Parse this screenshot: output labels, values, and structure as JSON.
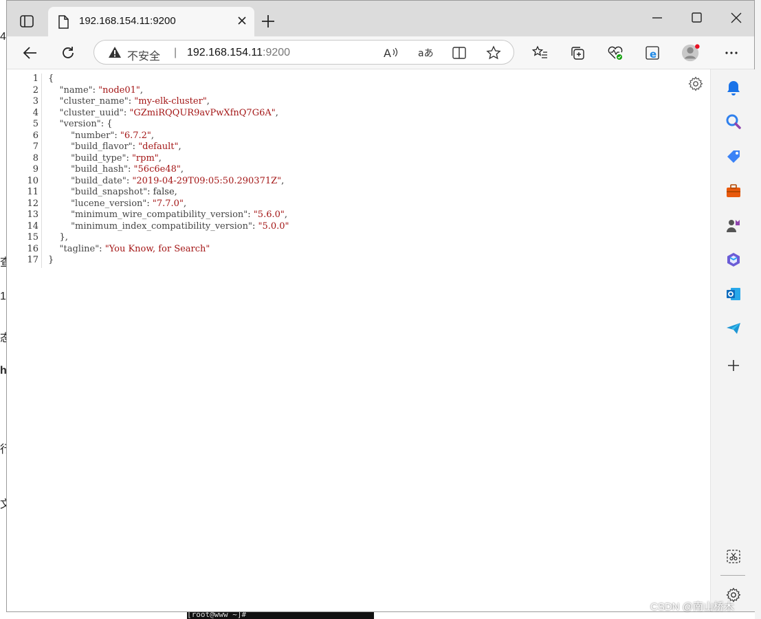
{
  "tab": {
    "title": "192.168.154.11:9200"
  },
  "address": {
    "security_label": "不安全",
    "separator": "|",
    "host": "192.168.154.11",
    "port": ":9200"
  },
  "json_lines": [
    {
      "n": "1",
      "parts": [
        [
          "punct",
          "{"
        ]
      ]
    },
    {
      "n": "2",
      "parts": [
        [
          "ind",
          "    "
        ],
        [
          "key",
          "\"name\""
        ],
        [
          "punct",
          ": "
        ],
        [
          "str",
          "\"node01\""
        ],
        [
          "punct",
          ","
        ]
      ]
    },
    {
      "n": "3",
      "parts": [
        [
          "ind",
          "    "
        ],
        [
          "key",
          "\"cluster_name\""
        ],
        [
          "punct",
          ": "
        ],
        [
          "str",
          "\"my-elk-cluster\""
        ],
        [
          "punct",
          ","
        ]
      ]
    },
    {
      "n": "4",
      "parts": [
        [
          "ind",
          "    "
        ],
        [
          "key",
          "\"cluster_uuid\""
        ],
        [
          "punct",
          ": "
        ],
        [
          "str",
          "\"GZmiRQQUR9avPwXfnQ7G6A\""
        ],
        [
          "punct",
          ","
        ]
      ]
    },
    {
      "n": "5",
      "parts": [
        [
          "ind",
          "    "
        ],
        [
          "key",
          "\"version\""
        ],
        [
          "punct",
          ": {"
        ]
      ]
    },
    {
      "n": "6",
      "parts": [
        [
          "ind",
          "        "
        ],
        [
          "key",
          "\"number\""
        ],
        [
          "punct",
          ": "
        ],
        [
          "str",
          "\"6.7.2\""
        ],
        [
          "punct",
          ","
        ]
      ]
    },
    {
      "n": "7",
      "parts": [
        [
          "ind",
          "        "
        ],
        [
          "key",
          "\"build_flavor\""
        ],
        [
          "punct",
          ": "
        ],
        [
          "str",
          "\"default\""
        ],
        [
          "punct",
          ","
        ]
      ]
    },
    {
      "n": "8",
      "parts": [
        [
          "ind",
          "        "
        ],
        [
          "key",
          "\"build_type\""
        ],
        [
          "punct",
          ": "
        ],
        [
          "str",
          "\"rpm\""
        ],
        [
          "punct",
          ","
        ]
      ]
    },
    {
      "n": "9",
      "parts": [
        [
          "ind",
          "        "
        ],
        [
          "key",
          "\"build_hash\""
        ],
        [
          "punct",
          ": "
        ],
        [
          "str",
          "\"56c6e48\""
        ],
        [
          "punct",
          ","
        ]
      ]
    },
    {
      "n": "10",
      "parts": [
        [
          "ind",
          "        "
        ],
        [
          "key",
          "\"build_date\""
        ],
        [
          "punct",
          ": "
        ],
        [
          "str",
          "\"2019-04-29T09:05:50.290371Z\""
        ],
        [
          "punct",
          ","
        ]
      ]
    },
    {
      "n": "11",
      "parts": [
        [
          "ind",
          "        "
        ],
        [
          "key",
          "\"build_snapshot\""
        ],
        [
          "punct",
          ": false,"
        ]
      ]
    },
    {
      "n": "12",
      "parts": [
        [
          "ind",
          "        "
        ],
        [
          "key",
          "\"lucene_version\""
        ],
        [
          "punct",
          ": "
        ],
        [
          "str",
          "\"7.7.0\""
        ],
        [
          "punct",
          ","
        ]
      ]
    },
    {
      "n": "13",
      "parts": [
        [
          "ind",
          "        "
        ],
        [
          "key",
          "\"minimum_wire_compatibility_version\""
        ],
        [
          "punct",
          ": "
        ],
        [
          "str",
          "\"5.6.0\""
        ],
        [
          "punct",
          ","
        ]
      ]
    },
    {
      "n": "14",
      "parts": [
        [
          "ind",
          "        "
        ],
        [
          "key",
          "\"minimum_index_compatibility_version\""
        ],
        [
          "punct",
          ": "
        ],
        [
          "str",
          "\"5.0.0\""
        ]
      ]
    },
    {
      "n": "15",
      "parts": [
        [
          "ind",
          "    "
        ],
        [
          "punct",
          "},"
        ]
      ]
    },
    {
      "n": "16",
      "parts": [
        [
          "ind",
          "    "
        ],
        [
          "key",
          "\"tagline\""
        ],
        [
          "punct",
          ": "
        ],
        [
          "str",
          "\"You Know, for Search\""
        ]
      ]
    },
    {
      "n": "17",
      "parts": [
        [
          "punct",
          "}"
        ]
      ]
    }
  ],
  "toolbar_icons": [
    "read-aloud-icon",
    "translate-icon",
    "split-screen-icon",
    "favorite-star-icon",
    "favorites-list-icon",
    "collections-icon",
    "browser-essentials-icon",
    "ie-mode-icon",
    "profile-avatar-icon",
    "more-menu-icon"
  ],
  "sidebar_icons": [
    "bell-icon",
    "search-icon",
    "shopping-tag-icon",
    "tools-briefcase-icon",
    "games-icon",
    "microsoft365-icon",
    "outlook-icon",
    "telegram-icon",
    "add-icon"
  ],
  "watermark": "CSDN @南山桥木",
  "colors": {
    "string": "#a31515",
    "key": "#444444",
    "accent_blue": "#0f6cbd"
  }
}
